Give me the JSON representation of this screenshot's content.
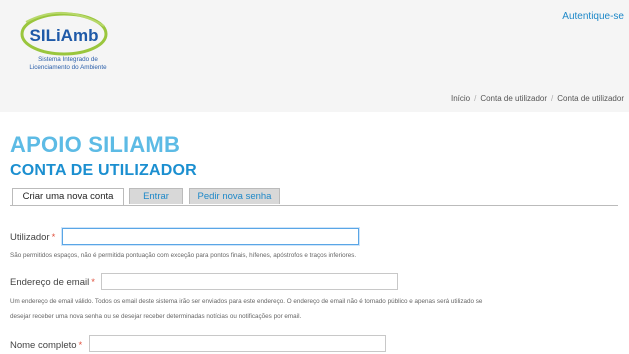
{
  "header": {
    "logo_text": "SILiAmb",
    "logo_subtitle_1": "Sistema Integrado de",
    "logo_subtitle_2": "Licenciamento do Ambiente",
    "login_link": "Autentique-se"
  },
  "breadcrumb": {
    "items": [
      "Início",
      "Conta de utilizador",
      "Conta de utilizador"
    ]
  },
  "page": {
    "title": "APOIO SILIAMB",
    "subtitle": "CONTA DE UTILIZADOR"
  },
  "tabs": [
    {
      "label": "Criar uma nova conta",
      "active": true
    },
    {
      "label": "Entrar",
      "active": false
    },
    {
      "label": "Pedir nova senha",
      "active": false
    }
  ],
  "form": {
    "username": {
      "label": "Utilizador",
      "required_mark": "*",
      "value": "",
      "help": "São permitidos espaços, não é permitida pontuação com exceção para pontos finais, hífenes, apóstrofos e traços inferiores."
    },
    "email": {
      "label": "Endereço de email",
      "required_mark": "*",
      "value": "",
      "help_1": "Um endereço de email válido. Todos os email deste sistema irão ser enviados para este endereço. O endereço de email não é tornado público e apenas será utilizado se",
      "help_2": "desejar receber uma nova senha ou se desejar receber determinadas notícias ou notificações por email."
    },
    "fullname": {
      "label": "Nome completo",
      "required_mark": "*",
      "value": ""
    }
  },
  "colors": {
    "title": "#5dbbe5",
    "subtitle": "#1b8fd0",
    "link": "#1e88c8",
    "required": "#e0523f",
    "header_bg": "#f5f5f5"
  }
}
